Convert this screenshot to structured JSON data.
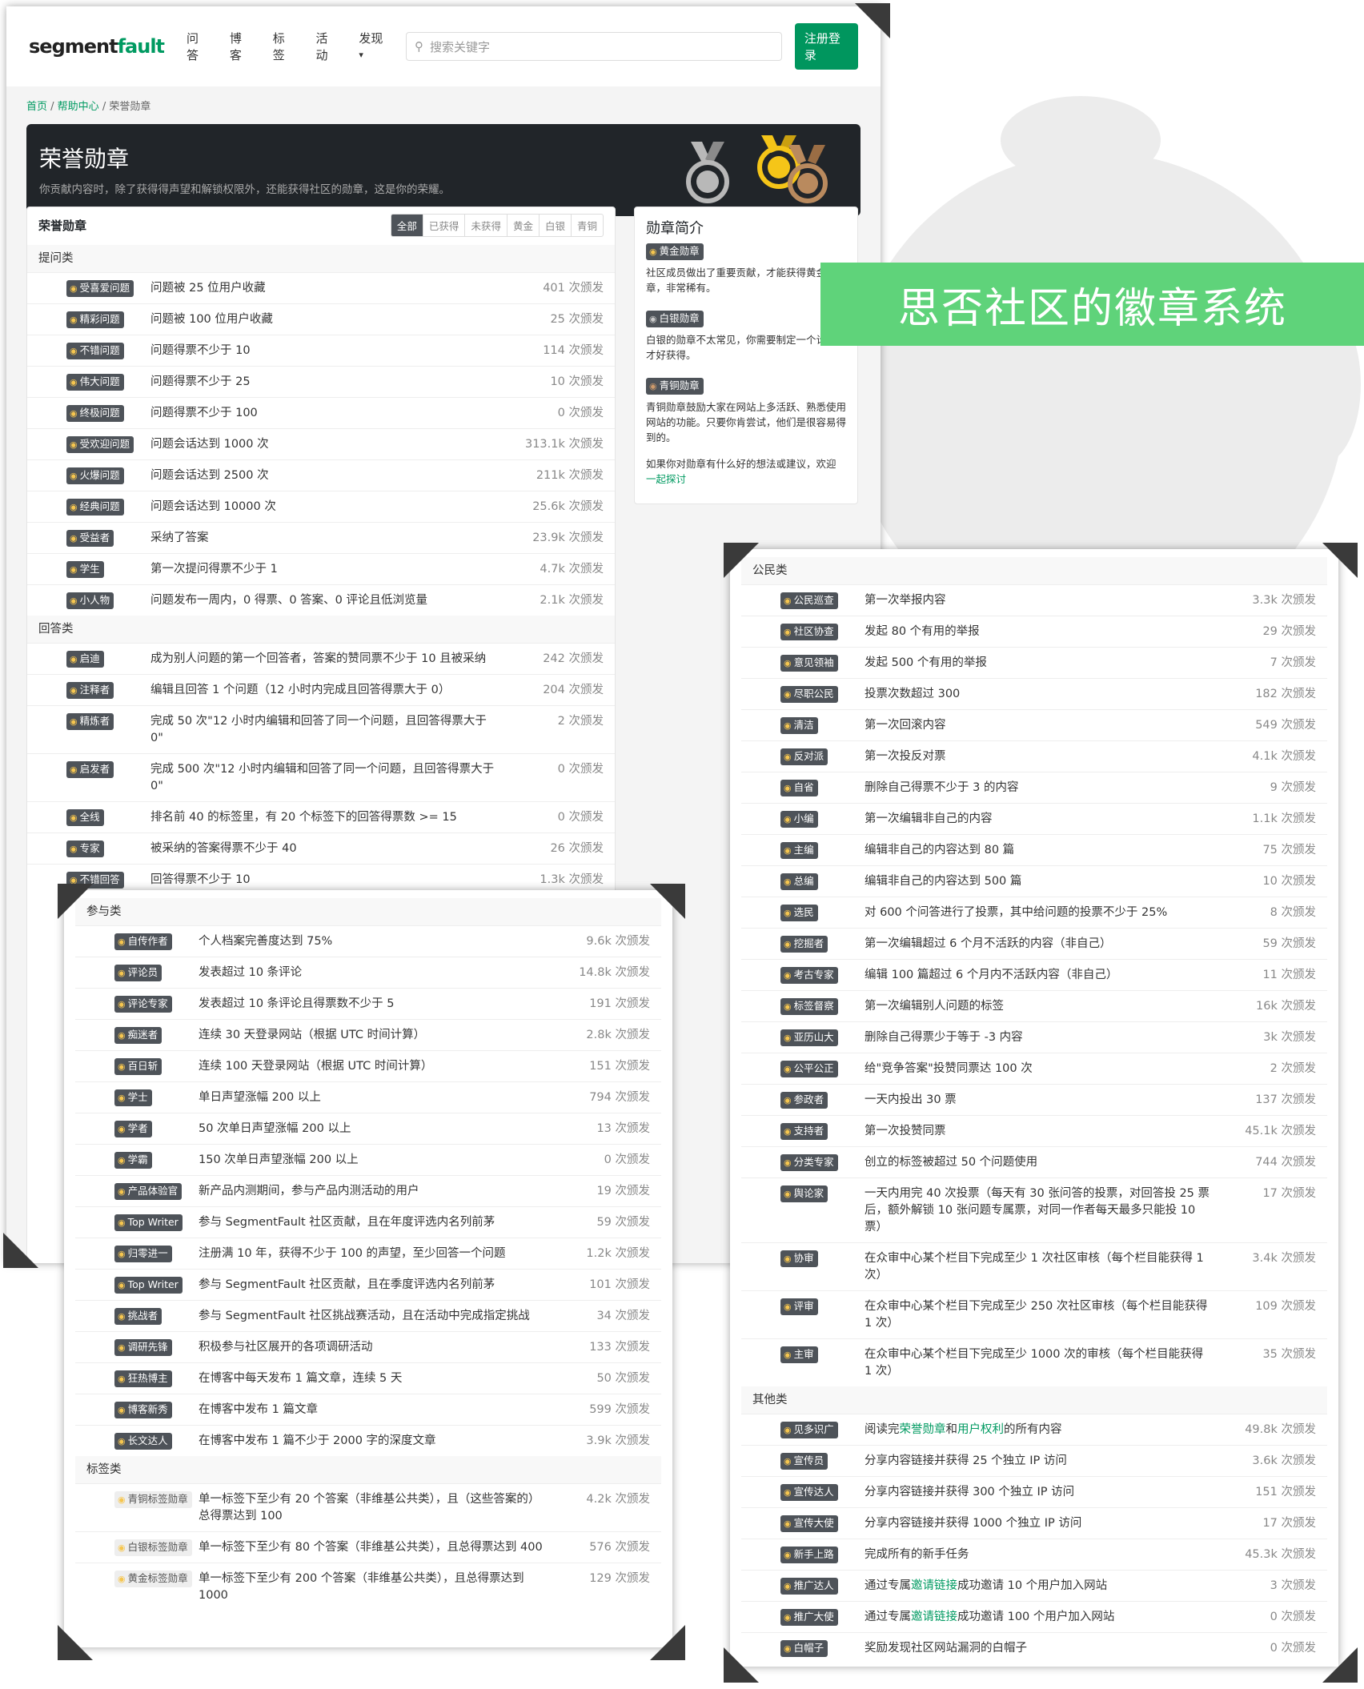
{
  "brand": {
    "name_a": "segment",
    "name_b": "fault"
  },
  "nav": [
    "问答",
    "博客",
    "标签",
    "活动",
    "发现"
  ],
  "nav_more": "▾",
  "search_placeholder": "搜索关键字",
  "login_button": "注册登录",
  "breadcrumb": [
    "首页",
    "帮助中心",
    "荣誉勋章"
  ],
  "banner": {
    "title": "荣誉勋章",
    "subtitle": "你贡献内容时，除了获得得声望和解锁权限外，还能获得社区的勋章，这是你的荣耀。"
  },
  "overlay_caption": "思否社区的徽章系统",
  "main": {
    "title": "荣誉勋章",
    "filters": [
      "全部",
      "已获得",
      "未获得",
      "黄金",
      "白银",
      "青铜"
    ]
  },
  "sidebar": {
    "title": "勋章简介",
    "gold_badge": "黄金勋章",
    "gold_text": "社区成员做出了重要贡献，才能获得黄金勋章，非常稀有。",
    "silver_badge": "白银勋章",
    "silver_text": "白银的勋章不太常见，你需要制定一个计划，才好获得。",
    "bronze_badge": "青铜勋章",
    "bronze_text": "青铜勋章鼓励大家在网站上多活跃、熟悉使用网站的功能。只要你肯尝试，他们是很容易得到的。",
    "footer_text": "如果你对勋章有什么好的想法或建议，欢迎",
    "footer_link": "一起探讨"
  },
  "sec_ask": {
    "title": "提问类",
    "rows": [
      {
        "b": "受喜爱问题",
        "d": "问题被 25 位用户收藏",
        "c": "401 次颁发"
      },
      {
        "b": "精彩问题",
        "d": "问题被 100 位用户收藏",
        "c": "25 次颁发"
      },
      {
        "b": "不错问题",
        "d": "问题得票不少于 10",
        "c": "114 次颁发"
      },
      {
        "b": "伟大问题",
        "d": "问题得票不少于 25",
        "c": "10 次颁发"
      },
      {
        "b": "终极问题",
        "d": "问题得票不少于 100",
        "c": "0 次颁发"
      },
      {
        "b": "受欢迎问题",
        "d": "问题会话达到 1000 次",
        "c": "313.1k 次颁发"
      },
      {
        "b": "火爆问题",
        "d": "问题会话达到 2500 次",
        "c": "211k 次颁发"
      },
      {
        "b": "经典问题",
        "d": "问题会话达到 10000 次",
        "c": "25.6k 次颁发"
      },
      {
        "b": "受益者",
        "d": "采纳了答案",
        "c": "23.9k 次颁发"
      },
      {
        "b": "学生",
        "d": "第一次提问得票不少于 1",
        "c": "4.7k 次颁发"
      },
      {
        "b": "小人物",
        "d": "问题发布一周内，0 得票、0 答案、0 评论且低浏览量",
        "c": "2.1k 次颁发"
      }
    ]
  },
  "sec_answer": {
    "title": "回答类",
    "rows": [
      {
        "b": "启迪",
        "d": "成为别人问题的第一个回答者，答案的赞同票不少于 10 且被采纳",
        "c": "242 次颁发"
      },
      {
        "b": "注释者",
        "d": "编辑且回答 1 个问题（12 小时内完成且回答得票大于 0）",
        "c": "204 次颁发"
      },
      {
        "b": "精炼者",
        "d": "完成 50 次\"12 小时内编辑和回答了同一个问题，且回答得票大于 0\"",
        "c": "2 次颁发"
      },
      {
        "b": "启发者",
        "d": "完成 500 次\"12 小时内编辑和回答了同一个问题，且回答得票大于 0\"",
        "c": "0 次颁发"
      },
      {
        "b": "全线",
        "d": "排名前 40 的标签里，有 20 个标签下的回答得票数 >= 15",
        "c": "0 次颁发"
      },
      {
        "b": "专家",
        "d": "被采纳的答案得票不少于 40",
        "c": "26 次颁发"
      },
      {
        "b": "不错回答",
        "d": "回答得票不少于 10",
        "c": "1.3k 次颁发"
      }
    ]
  },
  "sec_join": {
    "title": "参与类",
    "rows": [
      {
        "b": "自传作者",
        "d": "个人档案完善度达到 75%",
        "c": "9.6k 次颁发"
      },
      {
        "b": "评论员",
        "d": "发表超过 10 条评论",
        "c": "14.8k 次颁发"
      },
      {
        "b": "评论专家",
        "d": "发表超过 10 条评论且得票数不少于 5",
        "c": "191 次颁发"
      },
      {
        "b": "痴迷者",
        "d": "连续 30 天登录网站（根据 UTC 时间计算）",
        "c": "2.8k 次颁发"
      },
      {
        "b": "百日斩",
        "d": "连续 100 天登录网站（根据 UTC 时间计算）",
        "c": "151 次颁发"
      },
      {
        "b": "学士",
        "d": "单日声望涨幅 200 以上",
        "c": "794 次颁发"
      },
      {
        "b": "学者",
        "d": "50 次单日声望涨幅 200 以上",
        "c": "13 次颁发"
      },
      {
        "b": "学霸",
        "d": "150 次单日声望涨幅 200 以上",
        "c": "0 次颁发"
      },
      {
        "b": "产品体验官",
        "d": "新产品内测期间，参与产品内测活动的用户",
        "c": "19 次颁发"
      },
      {
        "b": "Top Writer",
        "d": "参与 SegmentFault 社区贡献，且在年度评选内名列前茅",
        "c": "59 次颁发"
      },
      {
        "b": "归零进一",
        "d": "注册满 10 年，获得不少于 100 的声望，至少回答一个问题",
        "c": "1.2k 次颁发"
      },
      {
        "b": "Top Writer",
        "d": "参与 SegmentFault 社区贡献，且在季度评选内名列前茅",
        "c": "101 次颁发"
      },
      {
        "b": "挑战者",
        "d": "参与 SegmentFault 社区挑战赛活动，且在活动中完成指定挑战",
        "c": "34 次颁发"
      },
      {
        "b": "调研先锋",
        "d": "积极参与社区展开的各项调研活动",
        "c": "133 次颁发"
      },
      {
        "b": "狂热博主",
        "d": "在博客中每天发布 1 篇文章，连续 5 天",
        "c": "50 次颁发"
      },
      {
        "b": "博客新秀",
        "d": "在博客中发布 1 篇文章",
        "c": "599 次颁发"
      },
      {
        "b": "长文达人",
        "d": "在博客中发布 1 篇不少于 2000 字的深度文章",
        "c": "3.9k 次颁发"
      }
    ]
  },
  "sec_tag": {
    "title": "标签类",
    "rows": [
      {
        "b": "青铜标签勋章",
        "d": "单一标签下至少有 20 个答案（非维基公共类），且（这些答案的）总得票达到 100",
        "c": "4.2k 次颁发"
      },
      {
        "b": "白银标签勋章",
        "d": "单一标签下至少有 80 个答案（非维基公共类），且总得票达到 400",
        "c": "576 次颁发"
      },
      {
        "b": "黄金标签勋章",
        "d": "单一标签下至少有 200 个答案（非维基公共类），且总得票达到 1000",
        "c": "129 次颁发"
      }
    ]
  },
  "sec_citizen": {
    "title": "公民类",
    "rows": [
      {
        "b": "公民巡查",
        "d": "第一次举报内容",
        "c": "3.3k 次颁发"
      },
      {
        "b": "社区协查",
        "d": "发起 80 个有用的举报",
        "c": "29 次颁发"
      },
      {
        "b": "意见领袖",
        "d": "发起 500 个有用的举报",
        "c": "7 次颁发"
      },
      {
        "b": "尽职公民",
        "d": "投票次数超过 300",
        "c": "182 次颁发"
      },
      {
        "b": "清洁",
        "d": "第一次回滚内容",
        "c": "549 次颁发"
      },
      {
        "b": "反对派",
        "d": "第一次投反对票",
        "c": "4.1k 次颁发"
      },
      {
        "b": "自省",
        "d": "删除自己得票不少于 3 的内容",
        "c": "9 次颁发"
      },
      {
        "b": "小编",
        "d": "第一次编辑非自己的内容",
        "c": "1.1k 次颁发"
      },
      {
        "b": "主编",
        "d": "编辑非自己的内容达到 80 篇",
        "c": "75 次颁发"
      },
      {
        "b": "总编",
        "d": "编辑非自己的内容达到 500 篇",
        "c": "10 次颁发"
      },
      {
        "b": "选民",
        "d": "对 600 个问答进行了投票，其中给问题的投票不少于 25%",
        "c": "8 次颁发"
      },
      {
        "b": "挖掘者",
        "d": "第一次编辑超过 6 个月不活跃的内容（非自己）",
        "c": "59 次颁发"
      },
      {
        "b": "考古专家",
        "d": "编辑 100 篇超过 6 个月内不活跃内容（非自己）",
        "c": "11 次颁发"
      },
      {
        "b": "标签督察",
        "d": "第一次编辑别人问题的标签",
        "c": "16k 次颁发"
      },
      {
        "b": "亚历山大",
        "d": "删除自己得票少于等于 -3 内容",
        "c": "3k 次颁发"
      },
      {
        "b": "公平公正",
        "d": "给\"竞争答案\"投赞同票达 100 次",
        "c": "2 次颁发"
      },
      {
        "b": "参政者",
        "d": "一天内投出 30 票",
        "c": "137 次颁发"
      },
      {
        "b": "支持者",
        "d": "第一次投赞同票",
        "c": "45.1k 次颁发"
      },
      {
        "b": "分类专家",
        "d": "创立的标签被超过 50 个问题使用",
        "c": "744 次颁发"
      },
      {
        "b": "舆论家",
        "d": "一天内用完 40 次投票（每天有 30 张问答的投票，对回答投 25 票后，额外解锁 10 张问题专属票，对同一作者每天最多只能投 10 票）",
        "c": "17 次颁发"
      },
      {
        "b": "协审",
        "d": "在众审中心某个栏目下完成至少 1 次社区审核（每个栏目能获得 1 次）",
        "c": "3.4k 次颁发"
      },
      {
        "b": "评审",
        "d": "在众审中心某个栏目下完成至少 250 次社区审核（每个栏目能获得 1 次）",
        "c": "109 次颁发"
      },
      {
        "b": "主审",
        "d": "在众审中心某个栏目下完成至少 1000 次的审核（每个栏目能获得 1 次）",
        "c": "35 次颁发"
      }
    ]
  },
  "sec_other": {
    "title": "其他类",
    "rows": [
      {
        "b": "见多识广",
        "d1": "阅读完",
        "l1": "荣誉勋章",
        "d2": "和",
        "l2": "用户权利",
        "d3": "的所有内容",
        "c": "49.8k 次颁发"
      },
      {
        "b": "宣传员",
        "d": "分享内容链接并获得 25 个独立 IP 访问",
        "c": "3.6k 次颁发"
      },
      {
        "b": "宣传达人",
        "d": "分享内容链接并获得 300 个独立 IP 访问",
        "c": "151 次颁发"
      },
      {
        "b": "宣传大使",
        "d": "分享内容链接并获得 1000 个独立 IP 访问",
        "c": "17 次颁发"
      },
      {
        "b": "新手上路",
        "d": "完成所有的新手任务",
        "c": "45.3k 次颁发"
      },
      {
        "b": "推广达人",
        "d1": "通过专属",
        "l1": "邀请链接",
        "d3": "成功邀请 10 个用户加入网站",
        "c": "3 次颁发"
      },
      {
        "b": "推广大使",
        "d1": "通过专属",
        "l1": "邀请链接",
        "d3": "成功邀请 100 个用户加入网站",
        "c": "0 次颁发"
      },
      {
        "b": "白帽子",
        "d": "奖励发现社区网站漏洞的白帽子",
        "c": "0 次颁发"
      }
    ]
  }
}
